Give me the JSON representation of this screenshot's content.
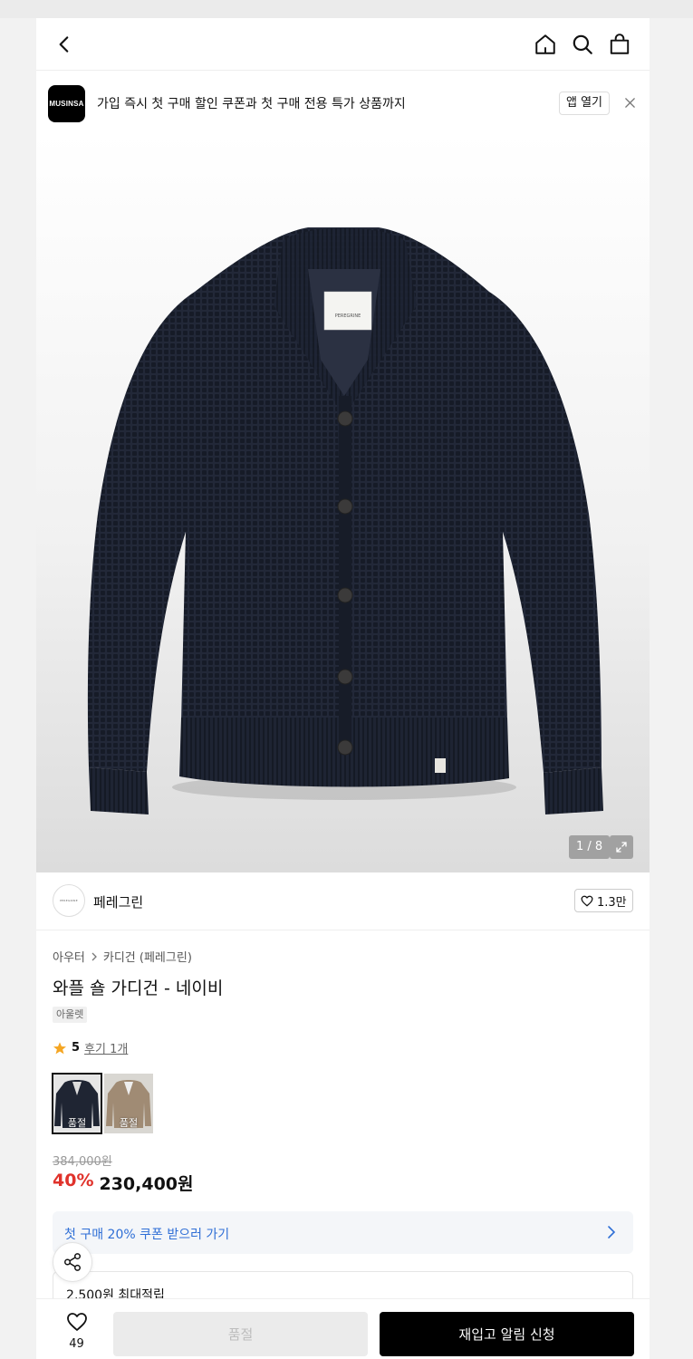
{
  "header": {
    "back_icon": "chevron-left-icon",
    "home_icon": "home-icon",
    "search_icon": "search-icon",
    "cart_icon": "shopping-bag-icon"
  },
  "banner": {
    "logo_text": "MUSINSA",
    "message": "가입 즉시 첫 구매 할인 쿠폰과 첫 구매 전용 특가 상품까지",
    "open_app_label": "앱 열기",
    "close_icon": "close-icon"
  },
  "gallery": {
    "counter": "1 / 8",
    "expand_icon": "expand-icon",
    "garment_label": "PEREGRINE"
  },
  "brand": {
    "logo_text": "PEREGRINE",
    "name": "페레그린",
    "likes": "1.3만"
  },
  "breadcrumb": {
    "category": "아우터",
    "subcategory": "카디건 (페레그린)"
  },
  "product": {
    "title": "와플 숄 가디건 - 네이비",
    "tag": "아울렛",
    "rating": "5",
    "reviews": "후기 1개",
    "thumbnails": [
      {
        "color": "#1f2533",
        "soldout": "품절"
      },
      {
        "color": "#a08b74",
        "soldout": "품절"
      }
    ],
    "original_price": "384,000원",
    "discount": "40%",
    "sale_price": "230,400원"
  },
  "coupon": {
    "text": "첫 구매 20% 쿠폰 받으러 가기"
  },
  "points": {
    "text": "2,500원 최대적립"
  },
  "bottom_bar": {
    "wish_count": "49",
    "soldout_label": "품절",
    "restock_label": "재입고 알림 신청"
  },
  "colors": {
    "accent_red": "#e0322b",
    "link_blue": "#2f6fd6",
    "primary_black": "#000000",
    "cardigan_navy": "#1f2533"
  }
}
